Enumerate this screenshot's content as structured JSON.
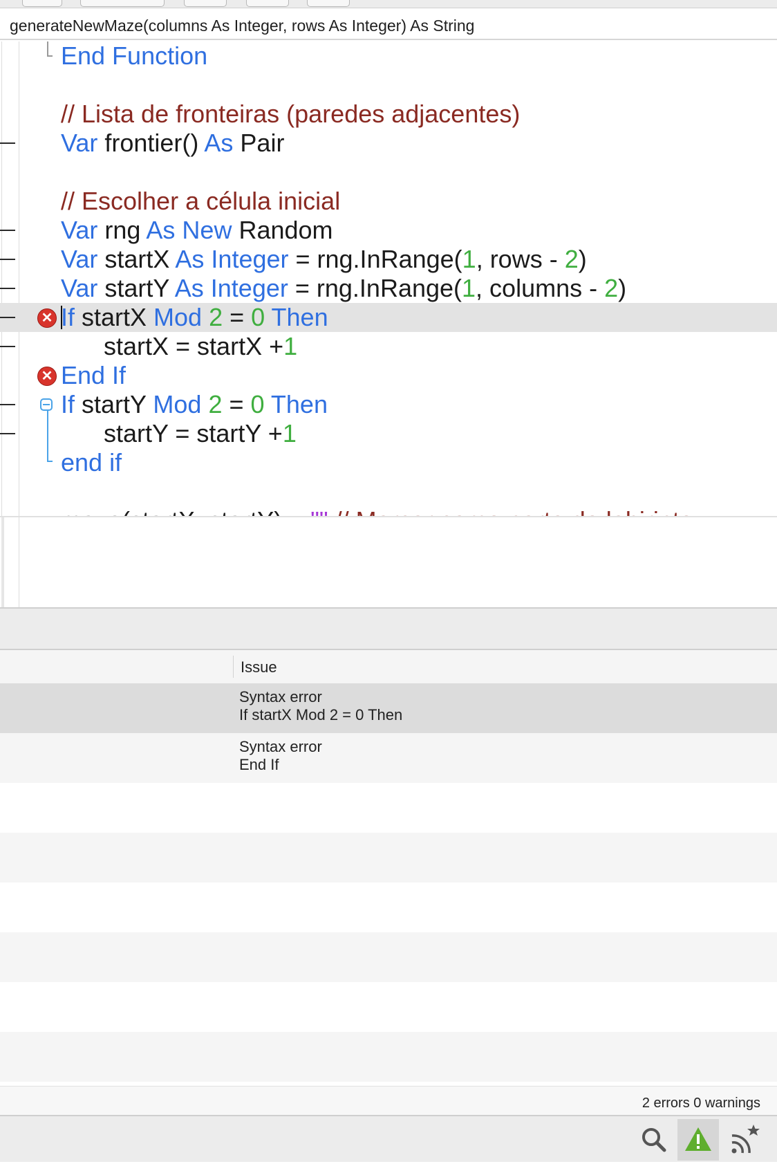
{
  "signature_bar": {
    "text": "generateNewMaze(columns As Integer, rows As Integer) As String"
  },
  "code_lines": {
    "l0": {
      "a": "End Function"
    },
    "l2": {
      "a": "// Lista de fronteiras (paredes adjacentes)"
    },
    "l3": {
      "a": "Var",
      "b": " frontier() ",
      "c": "As",
      "d": " Pair"
    },
    "l5": {
      "a": "// Escolher a célula inicial"
    },
    "l6": {
      "a": "Var",
      "b": " rng ",
      "c": "As New",
      "d": " Random"
    },
    "l7": {
      "a": "Var",
      "b": " startX ",
      "c": "As Integer",
      "d": " = rng.InRange(",
      "e": "1",
      "f": ", rows - ",
      "g": "2",
      "h": ")"
    },
    "l8": {
      "a": "Var",
      "b": " startY ",
      "c": "As Integer",
      "d": " = rng.InRange(",
      "e": "1",
      "f": ", columns - ",
      "g": "2",
      "h": ")"
    },
    "l9": {
      "a": "If",
      "b": " startX ",
      "c": "Mod",
      "d": " ",
      "e": "2",
      "f": " = ",
      "g": "0",
      "h": " ",
      "i": "Then"
    },
    "l10": {
      "a": "startX = startX +",
      "b": "1"
    },
    "l11": {
      "a": "End If"
    },
    "l12": {
      "a": "If",
      "b": " startY ",
      "c": "Mod",
      "d": " ",
      "e": "2",
      "f": " = ",
      "g": "0",
      "h": " ",
      "i": "Then"
    },
    "l13": {
      "a": "startY = startY +",
      "b": "1"
    },
    "l14": {
      "a": "end if"
    },
    "l16": {
      "a": "maze(startX, startY) = ",
      "b": "\"\"",
      "c": " // Marcar como parte do labirinto"
    }
  },
  "error_icons": [
    "x",
    "x"
  ],
  "issues_header": {
    "issue": "Issue"
  },
  "issues": [
    {
      "title": "Syntax error",
      "detail": "If startX Mod 2 = 0 Then"
    },
    {
      "title": "Syntax error",
      "detail": "End If"
    }
  ],
  "status": {
    "summary": "2 errors 0 warnings"
  },
  "bottom_bar_icons": [
    "search-icon",
    "warning-icon",
    "feed-icon"
  ],
  "colors": {
    "keyword": "#2f6fe0",
    "number": "#3fae3f",
    "comment": "#8a2a22",
    "string": "#a637d6",
    "error": "#d8342c",
    "warning": "#5fae2e"
  }
}
